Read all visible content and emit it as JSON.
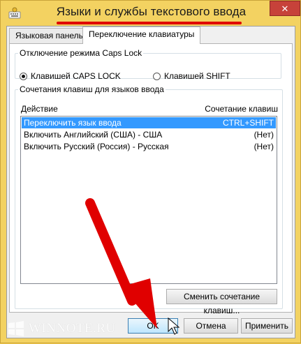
{
  "window": {
    "title": "Языки и службы текстового ввода",
    "close_glyph": "✕"
  },
  "tabs": [
    {
      "label": "Языковая панель",
      "active": false
    },
    {
      "label": "Переключение клавиатуры",
      "active": true
    }
  ],
  "caps_lock": {
    "group_label": "Отключение режима Caps Lock",
    "options": [
      {
        "label": "Клавишей CAPS LOCK",
        "checked": true
      },
      {
        "label": "Клавишей SHIFT",
        "checked": false
      }
    ]
  },
  "hotkeys": {
    "group_label": "Сочетания клавиш для языков ввода",
    "columns": [
      "Действие",
      "Сочетание клавиш"
    ],
    "rows": [
      {
        "action": "Переключить язык ввода",
        "keys": "CTRL+SHIFT",
        "selected": true
      },
      {
        "action": "Включить Английский (США) - США",
        "keys": "(Нет)",
        "selected": false
      },
      {
        "action": "Включить Русский (Россия) - Русская",
        "keys": "(Нет)",
        "selected": false
      }
    ],
    "change_button": "Сменить сочетание клавиш..."
  },
  "buttons": {
    "ok": "OK",
    "cancel": "Отмена",
    "apply": "Применить"
  },
  "watermark": {
    "text": "WINNOTE.RU"
  },
  "colors": {
    "frame": "#f3d261",
    "selection": "#3399ff",
    "annotation_red": "#e00000"
  }
}
